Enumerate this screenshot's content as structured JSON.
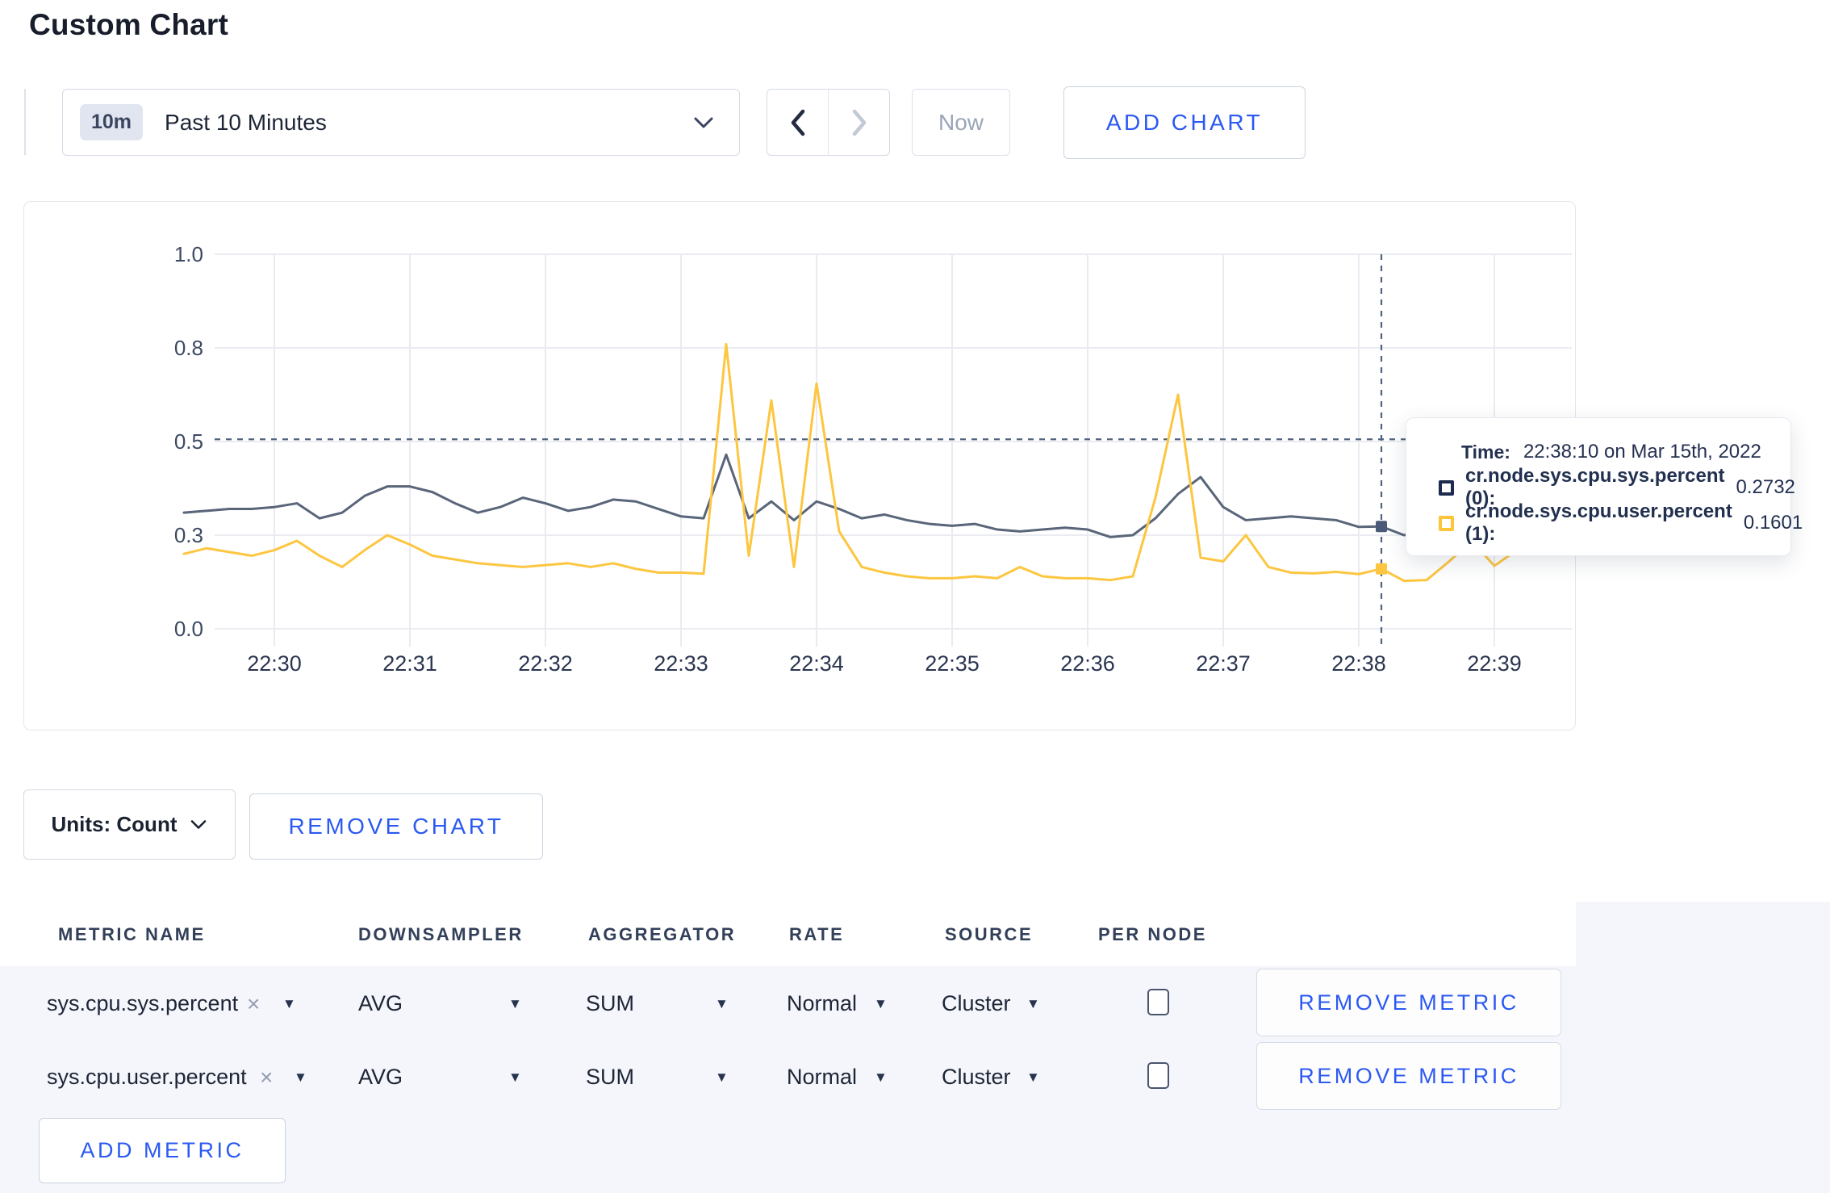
{
  "page": {
    "title": "Custom Chart"
  },
  "toolbar": {
    "range_badge": "10m",
    "range_label": "Past 10 Minutes",
    "now_label": "Now",
    "add_chart_label": "ADD CHART"
  },
  "chart_data": {
    "type": "line",
    "x_start_time": "22:29:20",
    "x_step_seconds": 10,
    "x_tick_labels": [
      "22:30",
      "22:31",
      "22:32",
      "22:33",
      "22:34",
      "22:35",
      "22:36",
      "22:37",
      "22:38",
      "22:39"
    ],
    "y_ticks": [
      {
        "label": "0.0",
        "value": 0.0
      },
      {
        "label": "0.3",
        "value": 0.25
      },
      {
        "label": "0.5",
        "value": 0.5
      },
      {
        "label": "0.8",
        "value": 0.75
      },
      {
        "label": "1.0",
        "value": 1.0
      }
    ],
    "ylim": [
      0,
      1
    ],
    "grid": true,
    "legend_position": "tooltip",
    "series": [
      {
        "name": "cr.node.sys.cpu.sys.percent (0)",
        "color": "#596579",
        "values": [
          0.31,
          0.315,
          0.32,
          0.32,
          0.325,
          0.335,
          0.295,
          0.31,
          0.355,
          0.38,
          0.38,
          0.365,
          0.335,
          0.31,
          0.325,
          0.35,
          0.335,
          0.315,
          0.325,
          0.345,
          0.34,
          0.32,
          0.3,
          0.295,
          0.465,
          0.295,
          0.34,
          0.29,
          0.34,
          0.32,
          0.295,
          0.305,
          0.29,
          0.28,
          0.275,
          0.28,
          0.265,
          0.26,
          0.265,
          0.27,
          0.265,
          0.245,
          0.25,
          0.295,
          0.36,
          0.405,
          0.325,
          0.29,
          0.295,
          0.3,
          0.295,
          0.29,
          0.272,
          0.2732,
          0.25,
          0.26,
          0.27,
          0.28,
          0.29,
          0.295
        ]
      },
      {
        "name": "cr.node.sys.cpu.user.percent (1)",
        "color": "#fcc640",
        "values": [
          0.2,
          0.215,
          0.205,
          0.195,
          0.21,
          0.235,
          0.195,
          0.165,
          0.21,
          0.25,
          0.225,
          0.195,
          0.185,
          0.175,
          0.17,
          0.165,
          0.17,
          0.175,
          0.165,
          0.175,
          0.16,
          0.15,
          0.15,
          0.147,
          0.76,
          0.195,
          0.61,
          0.165,
          0.655,
          0.26,
          0.165,
          0.15,
          0.14,
          0.135,
          0.135,
          0.14,
          0.135,
          0.165,
          0.14,
          0.135,
          0.135,
          0.13,
          0.14,
          0.35,
          0.625,
          0.19,
          0.18,
          0.25,
          0.165,
          0.15,
          0.148,
          0.152,
          0.146,
          0.1601,
          0.128,
          0.13,
          0.18,
          0.235,
          0.168,
          0.21
        ]
      }
    ],
    "crosshair": {
      "x_index": 53,
      "time": "22:38:10",
      "y_value": 0.506
    }
  },
  "tooltip": {
    "time_label": "Time:",
    "time_value": "22:38:10 on Mar 15th, 2022",
    "rows": [
      {
        "name": "cr.node.sys.cpu.sys.percent (0):",
        "value": "0.2732",
        "color": "#1e2b4e"
      },
      {
        "name": "cr.node.sys.cpu.user.percent (1):",
        "value": "0.1601",
        "color": "#fdc53a"
      }
    ]
  },
  "units": {
    "label": "Units: Count"
  },
  "chart_actions": {
    "remove_chart_label": "REMOVE CHART"
  },
  "metrics_table": {
    "headers": [
      "METRIC NAME",
      "DOWNSAMPLER",
      "AGGREGATOR",
      "RATE",
      "SOURCE",
      "PER NODE"
    ],
    "rows": [
      {
        "metric": "sys.cpu.sys.percent",
        "downsampler": "AVG",
        "aggregator": "SUM",
        "rate": "Normal",
        "source": "Cluster",
        "per_node": false,
        "remove_label": "REMOVE METRIC"
      },
      {
        "metric": "sys.cpu.user.percent",
        "downsampler": "AVG",
        "aggregator": "SUM",
        "rate": "Normal",
        "source": "Cluster",
        "per_node": false,
        "remove_label": "REMOVE METRIC"
      }
    ],
    "add_metric_label": "ADD METRIC"
  },
  "colors": {
    "accent_blue": "#2b59f2",
    "series_sys": "#596579",
    "series_user": "#fcc640",
    "grid": "#eaecf2",
    "crosshair": "#51647f"
  }
}
